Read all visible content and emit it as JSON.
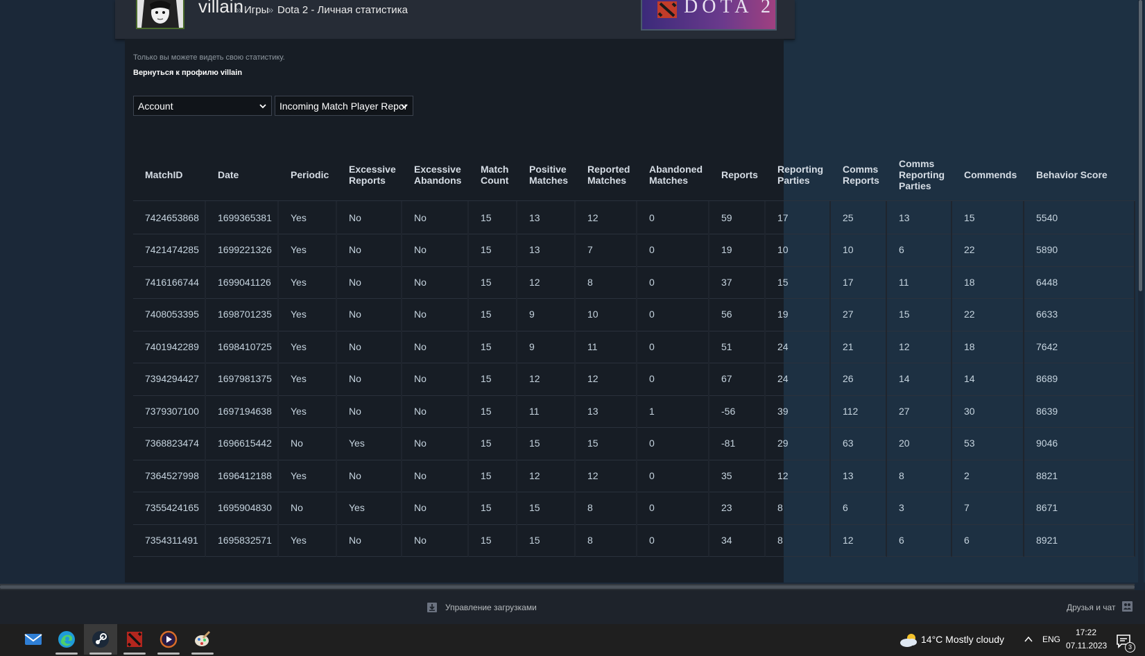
{
  "header": {
    "persona_name": "villain",
    "breadcrumb_sep": "»",
    "breadcrumb_games": "Игры",
    "breadcrumb_page": "Dota 2 - Личная статистика",
    "game_logo_text": "DOTA 2"
  },
  "notice": "Только вы можете видеть свою статистику.",
  "back_link": "Вернуться к профилю villain",
  "dropdowns": {
    "category": "Account",
    "report": "Incoming Match Player Repor"
  },
  "table": {
    "columns": [
      "MatchID",
      "Date",
      "Periodic",
      "Excessive Reports",
      "Excessive Abandons",
      "Match Count",
      "Positive Matches",
      "Reported Matches",
      "Abandoned Matches",
      "Reports",
      "Reporting Parties",
      "Comms Reports",
      "Comms Reporting Parties",
      "Commends",
      "Behavior Score"
    ],
    "rows": [
      [
        "7424653868",
        "1699365381",
        "Yes",
        "No",
        "No",
        "15",
        "13",
        "12",
        "0",
        "59",
        "17",
        "25",
        "13",
        "15",
        "5540"
      ],
      [
        "7421474285",
        "1699221326",
        "Yes",
        "No",
        "No",
        "15",
        "13",
        "7",
        "0",
        "19",
        "10",
        "10",
        "6",
        "22",
        "5890"
      ],
      [
        "7416166744",
        "1699041126",
        "Yes",
        "No",
        "No",
        "15",
        "12",
        "8",
        "0",
        "37",
        "15",
        "17",
        "11",
        "18",
        "6448"
      ],
      [
        "7408053395",
        "1698701235",
        "Yes",
        "No",
        "No",
        "15",
        "9",
        "10",
        "0",
        "56",
        "19",
        "27",
        "15",
        "22",
        "6633"
      ],
      [
        "7401942289",
        "1698410725",
        "Yes",
        "No",
        "No",
        "15",
        "9",
        "11",
        "0",
        "51",
        "24",
        "21",
        "12",
        "18",
        "7642"
      ],
      [
        "7394294427",
        "1697981375",
        "Yes",
        "No",
        "No",
        "15",
        "12",
        "12",
        "0",
        "67",
        "24",
        "26",
        "14",
        "14",
        "8689"
      ],
      [
        "7379307100",
        "1697194638",
        "Yes",
        "No",
        "No",
        "15",
        "11",
        "13",
        "1",
        "-56",
        "39",
        "112",
        "27",
        "30",
        "8639"
      ],
      [
        "7368823474",
        "1696615442",
        "No",
        "Yes",
        "No",
        "15",
        "15",
        "15",
        "0",
        "-81",
        "29",
        "63",
        "20",
        "53",
        "9046"
      ],
      [
        "7364527998",
        "1696412188",
        "Yes",
        "No",
        "No",
        "15",
        "12",
        "12",
        "0",
        "35",
        "12",
        "13",
        "8",
        "2",
        "8821"
      ],
      [
        "7355424165",
        "1695904830",
        "No",
        "Yes",
        "No",
        "15",
        "15",
        "8",
        "0",
        "23",
        "8",
        "6",
        "3",
        "7",
        "8671"
      ],
      [
        "7354311491",
        "1695832571",
        "Yes",
        "No",
        "No",
        "15",
        "15",
        "8",
        "0",
        "34",
        "8",
        "12",
        "6",
        "6",
        "8921"
      ]
    ]
  },
  "steam_bar": {
    "downloads": "Управление загрузками",
    "friends": "Друзья и чат"
  },
  "taskbar": {
    "apps": [
      "mail-icon",
      "edge-icon",
      "steam-icon",
      "dota-icon",
      "media-player-icon",
      "paint-icon"
    ],
    "weather": "14°C  Mostly cloudy",
    "lang": "ENG",
    "time": "17:22",
    "date": "07.11.2023",
    "notifications": "3"
  },
  "colors": {
    "page_bg": "#1b2838",
    "panel_bg": "#171d25",
    "header_bg": "#262c36",
    "taskbar_bg": "#1f1f1f"
  }
}
